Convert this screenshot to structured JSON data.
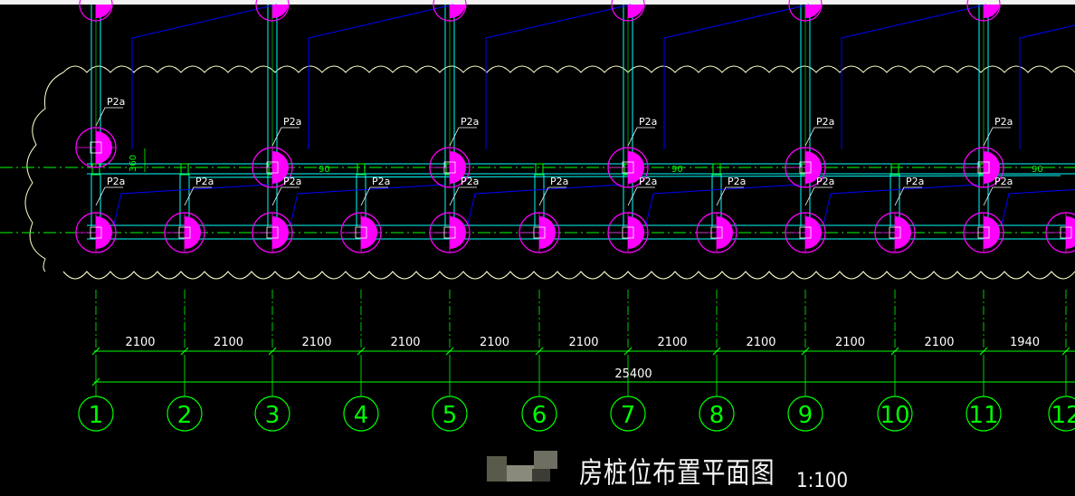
{
  "drawing": {
    "title": "房桩位布置平面图",
    "scale": "1:100",
    "pile_label": "P2a",
    "dim_offset": "360",
    "beam_dim": "90",
    "spans": [
      "2100",
      "2100",
      "2100",
      "2100",
      "2100",
      "2100",
      "2100",
      "2100",
      "2100",
      "2100",
      "1940"
    ],
    "total_length": "25400",
    "axis_labels": [
      "1",
      "2",
      "3",
      "4",
      "5",
      "6",
      "7",
      "8",
      "9",
      "10",
      "11",
      "12"
    ]
  },
  "colors": {
    "background": "#000000",
    "pile_fill": "#ff00ff",
    "pile_circle": "#ff00ff",
    "beam": "#00ffff",
    "dimension": "#00ff00",
    "leader": "#0000ff",
    "cloud": "#ffffcc",
    "text": "#ffffff"
  }
}
